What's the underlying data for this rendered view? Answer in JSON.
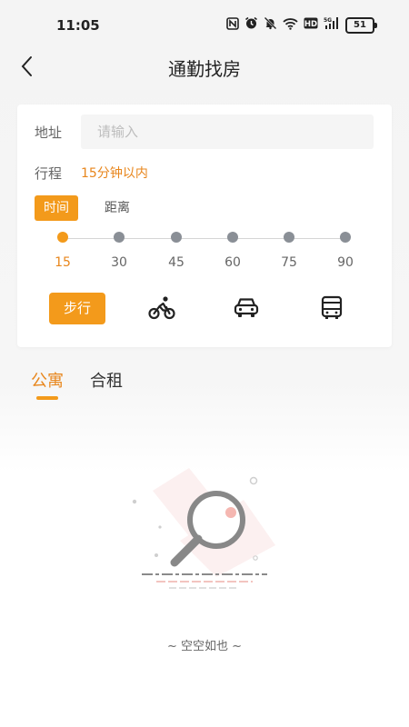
{
  "status_bar": {
    "time": "11:05",
    "icons": [
      "nfc-icon",
      "alarm-icon",
      "mute-bell-icon",
      "wifi-icon",
      "hd-icon",
      "signal-5g-icon"
    ],
    "battery": "51"
  },
  "nav": {
    "title": "通勤找房"
  },
  "search_form": {
    "address_label": "地址",
    "address_value": "",
    "address_placeholder": "请输入",
    "trip_label": "行程",
    "trip_value": "15分钟以内",
    "mode_tabs": [
      {
        "label": "时间",
        "active": true
      },
      {
        "label": "距离",
        "active": false
      }
    ],
    "slider": {
      "ticks": [
        "15",
        "30",
        "45",
        "60",
        "75",
        "90"
      ],
      "selected": "15"
    },
    "transport": [
      {
        "id": "walk",
        "label": "步行",
        "active": true
      },
      {
        "id": "bike",
        "icon": "bicycle-icon",
        "active": false
      },
      {
        "id": "car",
        "icon": "car-icon",
        "active": false
      },
      {
        "id": "bus",
        "icon": "bus-icon",
        "active": false
      }
    ]
  },
  "category_tabs": [
    {
      "label": "公寓",
      "active": true
    },
    {
      "label": "合租",
      "active": false
    }
  ],
  "empty_state": {
    "icon": "magnifier-empty-icon",
    "text": "~ 空空如也 ~"
  },
  "colors": {
    "accent": "#f39a1b",
    "accent_text": "#e8861c",
    "inactive_dot": "#8a8f96"
  }
}
